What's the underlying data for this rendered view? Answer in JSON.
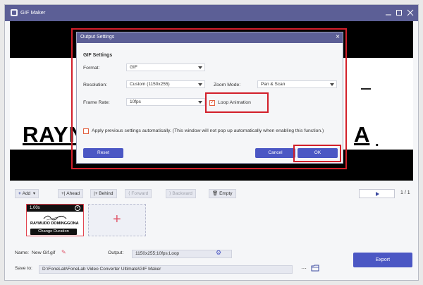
{
  "window": {
    "title": "GIF Maker",
    "minimize_icon": "minimize-icon",
    "maximize_icon": "maximize-icon",
    "close_icon": "close-icon"
  },
  "preview": {
    "text_left": "RAYN",
    "text_right": "A",
    "text_dot": "."
  },
  "dialog": {
    "title": "Output Settings",
    "section": "GIF Settings",
    "format_label": "Format:",
    "format_value": "GIF",
    "resolution_label": "Resolution:",
    "resolution_value": "Custom (1150x255)",
    "zoom_label": "Zoom Mode:",
    "zoom_value": "Pan & Scan",
    "frame_label": "Frame Rate:",
    "frame_value": "10fps",
    "loop_label": "Loop Animation",
    "loop_checked": true,
    "apply_label": "Apply previous settings automatically. (This window will not pop up automatically when enabling this function.)",
    "apply_checked": false,
    "reset_label": "Reset",
    "cancel_label": "Cancel",
    "ok_label": "OK",
    "accent_color": "#4b57c4",
    "highlight_color": "#d21f2a"
  },
  "toolbar": {
    "add": "Add",
    "ahead": "Ahead",
    "behind": "Behind",
    "forward": "Forward",
    "backward": "Backward",
    "empty": "Empty",
    "page": "1 / 1"
  },
  "timeline": {
    "clip_duration": "1.00s",
    "clip_caption": "RAYMUDO DOMINGGONA",
    "change_duration": "Change Duration"
  },
  "footer": {
    "name_label": "Name:",
    "name_value": "New Gif.gif",
    "output_label": "Output:",
    "output_value": "1150x255;10fps;Loop",
    "save_label": "Save to:",
    "save_path": "D:\\FoneLab\\FoneLab Video Converter Ultimate\\GIF Maker",
    "more": "···",
    "export": "Export"
  }
}
